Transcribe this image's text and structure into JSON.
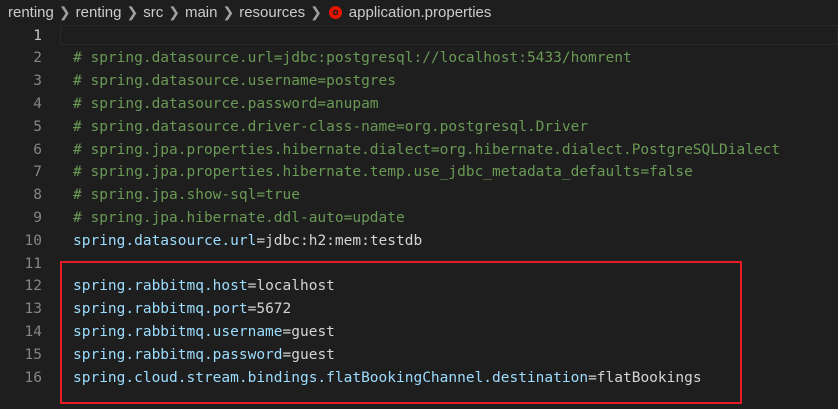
{
  "breadcrumb": {
    "items": [
      "renting",
      "renting",
      "src",
      "main",
      "resources"
    ],
    "file": "application.properties"
  },
  "editor": {
    "lines": [
      {
        "n": "1",
        "comment": "",
        "key": "",
        "value": ""
      },
      {
        "n": "2",
        "comment": "# spring.datasource.url=jdbc:postgresql://localhost:5433/homrent",
        "key": "",
        "value": ""
      },
      {
        "n": "3",
        "comment": "# spring.datasource.username=postgres",
        "key": "",
        "value": ""
      },
      {
        "n": "4",
        "comment": "# spring.datasource.password=anupam",
        "key": "",
        "value": ""
      },
      {
        "n": "5",
        "comment": "# spring.datasource.driver-class-name=org.postgresql.Driver",
        "key": "",
        "value": ""
      },
      {
        "n": "6",
        "comment": "# spring.jpa.properties.hibernate.dialect=org.hibernate.dialect.PostgreSQLDialect",
        "key": "",
        "value": ""
      },
      {
        "n": "7",
        "comment": "# spring.jpa.properties.hibernate.temp.use_jdbc_metadata_defaults=false",
        "key": "",
        "value": ""
      },
      {
        "n": "8",
        "comment": "# spring.jpa.show-sql=true",
        "key": "",
        "value": ""
      },
      {
        "n": "9",
        "comment": "# spring.jpa.hibernate.ddl-auto=update",
        "key": "",
        "value": ""
      },
      {
        "n": "10",
        "comment": "",
        "key": "spring.datasource.url",
        "value": "jdbc:h2:mem:testdb"
      },
      {
        "n": "11",
        "comment": "",
        "key": "",
        "value": ""
      },
      {
        "n": "12",
        "comment": "",
        "key": "spring.rabbitmq.host",
        "value": "localhost"
      },
      {
        "n": "13",
        "comment": "",
        "key": "spring.rabbitmq.port",
        "value": "5672"
      },
      {
        "n": "14",
        "comment": "",
        "key": "spring.rabbitmq.username",
        "value": "guest"
      },
      {
        "n": "15",
        "comment": "",
        "key": "spring.rabbitmq.password",
        "value": "guest"
      },
      {
        "n": "16",
        "comment": "",
        "key": "spring.cloud.stream.bindings.flatBookingChannel.destination",
        "value": "flatBookings"
      }
    ]
  },
  "colors": {
    "background": "#1e1e1e",
    "comment": "#6a9955",
    "property_key": "#9cdcfe",
    "value": "#d4d4d4",
    "line_number": "#858585",
    "annotation_box": "#e51c23",
    "file_icon": "#e51400"
  },
  "icons": {
    "separator": "chevron-right-icon",
    "file": "properties-file-icon"
  }
}
